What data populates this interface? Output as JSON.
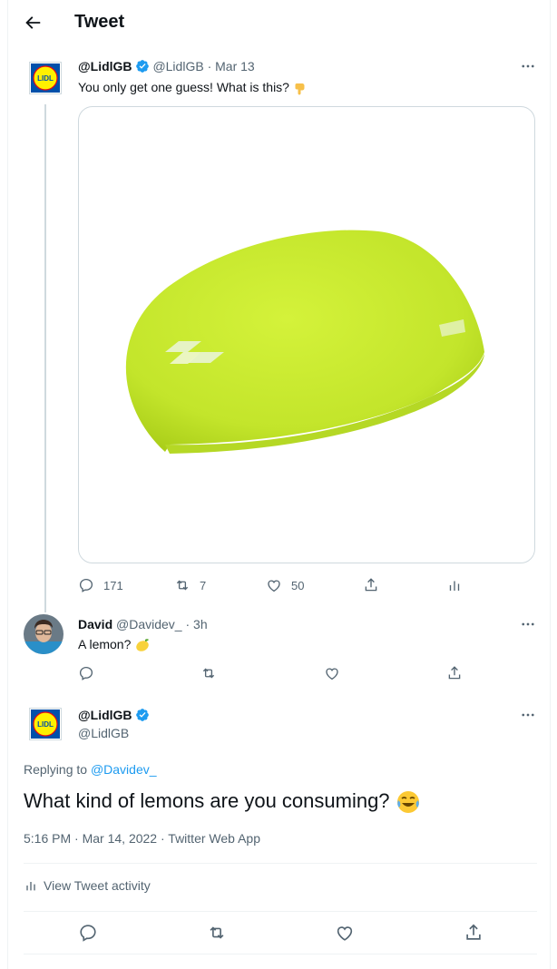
{
  "header": {
    "title": "Tweet",
    "back_icon": "arrow-left-icon"
  },
  "original_tweet": {
    "author_name": "@LidlGB",
    "handle": "@LidlGB",
    "separator": "·",
    "date": "Mar 13",
    "text": "You only get one guess! What is this?",
    "text_emoji": "pointing-down-hand-emoji",
    "media_description_icon": "swim-cap-image",
    "stats": {
      "replies": "171",
      "retweets": "7",
      "likes": "50"
    },
    "colors": {
      "cap": "#c6e82b",
      "verified": "#1d9bf0"
    }
  },
  "reply_tweet": {
    "author_name": "David",
    "handle": "@Davidev_",
    "separator": "·",
    "time": "3h",
    "text": "A lemon?",
    "text_emoji": "lemon-emoji"
  },
  "focus_tweet": {
    "author_name": "@LidlGB",
    "handle": "@LidlGB",
    "replying_prefix": "Replying to",
    "replying_to": "@Davidev_",
    "text": "What kind of lemons are you consuming?",
    "text_emoji": "tears-of-joy-emoji",
    "time": "5:16 PM",
    "date": "Mar 14, 2022",
    "separator": "·",
    "app": "Twitter Web App",
    "activity_label": "View Tweet activity"
  },
  "accent_color": "#1d9bf0"
}
